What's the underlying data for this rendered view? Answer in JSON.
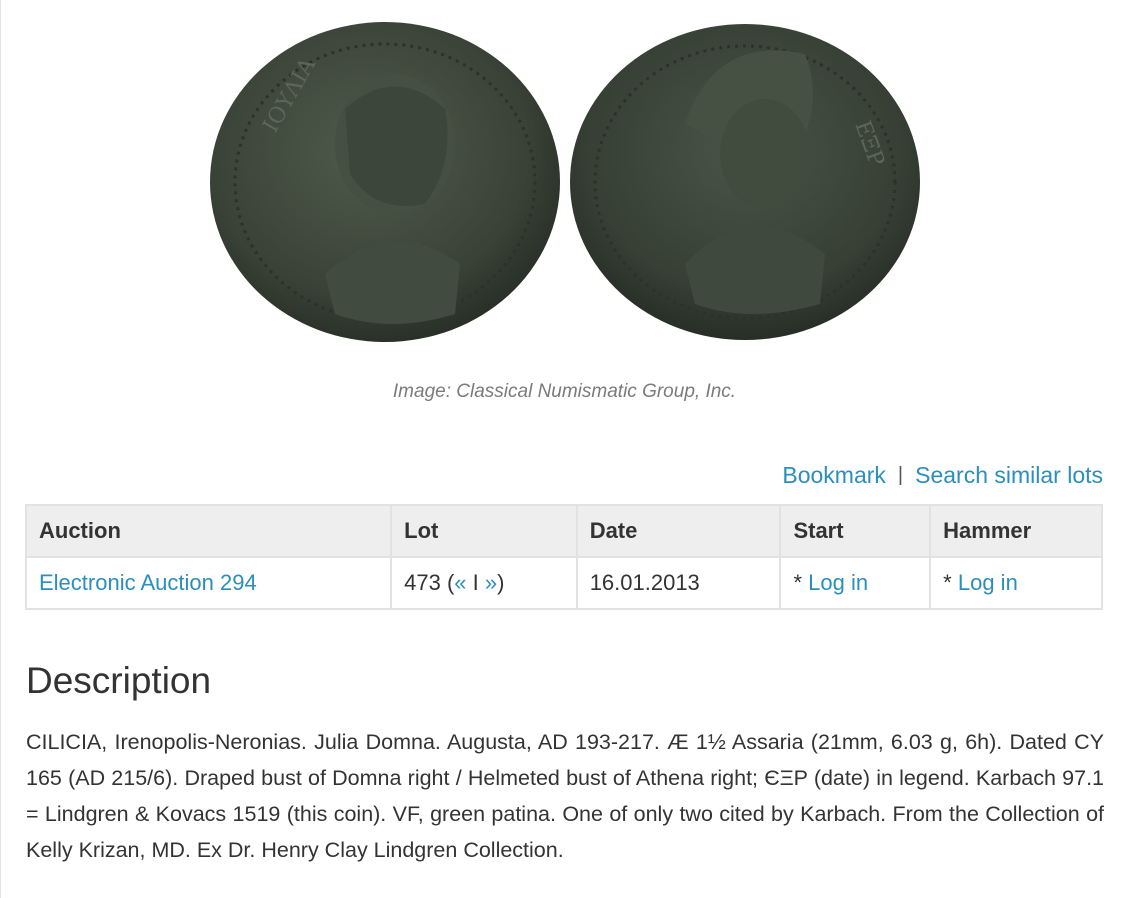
{
  "image": {
    "caption": "Image: Classical Numismatic Group, Inc.",
    "obverse_label": "Draped bust of Julia Domna right",
    "reverse_label": "Helmeted bust of Athena right"
  },
  "actions": {
    "bookmark": "Bookmark",
    "separator": "|",
    "search_similar": "Search similar lots"
  },
  "table": {
    "headers": [
      "Auction",
      "Lot",
      "Date",
      "Start",
      "Hammer"
    ],
    "row": {
      "auction": "Electronic Auction 294",
      "lot_number": "473",
      "lot_open": " (",
      "prev": "«",
      "lot_sep": " I ",
      "next": "»",
      "lot_close": ")",
      "date": "16.01.2013",
      "start_prefix": "* ",
      "start_link": "Log in",
      "hammer_prefix": "* ",
      "hammer_link": "Log in"
    }
  },
  "description": {
    "title": "Description",
    "text": "CILICIA, Irenopolis-Neronias. Julia Domna. Augusta, AD 193-217. Æ 1½ Assaria (21mm, 6.03 g, 6h). Dated CY 165 (AD 215/6). Draped bust of Domna right / Helmeted bust of Athena right; ЄΞΡ (date) in legend. Karbach 97.1 = Lindgren & Kovacs 1519 (this coin). VF, green patina. One of only two cited by Karbach. From the Collection of Kelly Krizan, MD. Ex Dr. Henry Clay Lindgren Collection."
  },
  "colors": {
    "link": "#2a8fbd",
    "header_bg": "#eeeeee",
    "border": "#e2e2e2",
    "coin_patina": "#3a4237"
  }
}
